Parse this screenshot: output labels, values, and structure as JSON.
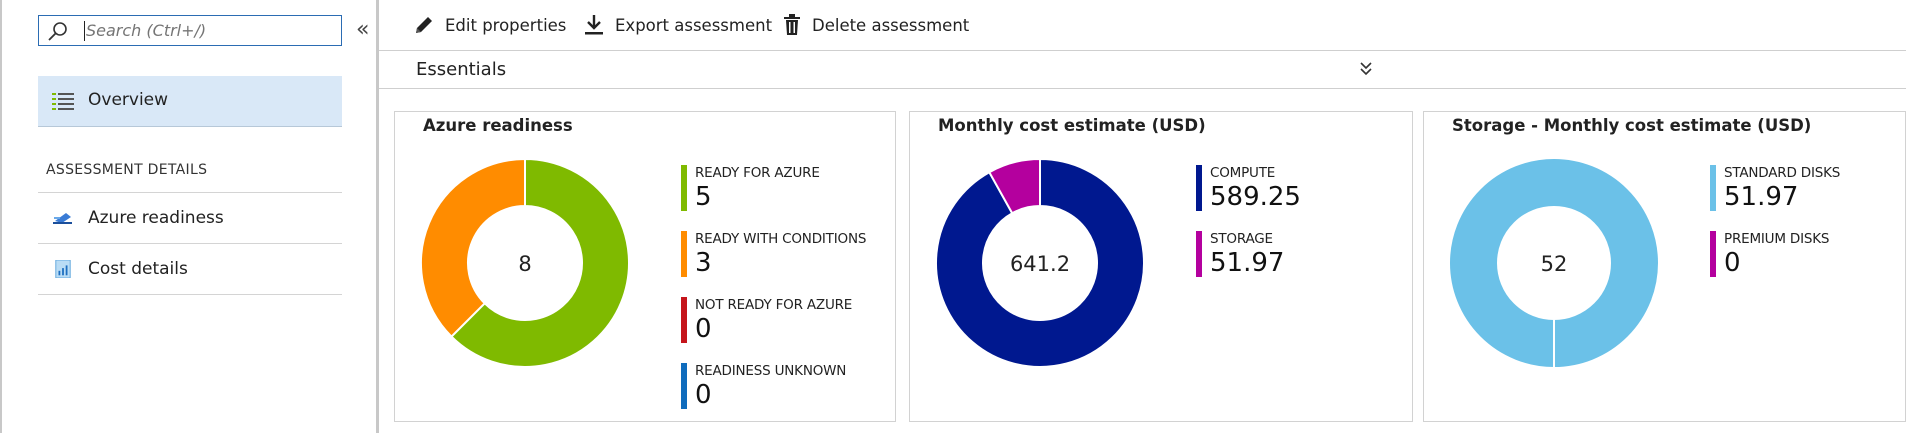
{
  "sidebar": {
    "search_placeholder": "Search (Ctrl+/)",
    "overview_label": "Overview",
    "section_title": "ASSESSMENT DETAILS",
    "items": [
      {
        "label": "Azure readiness",
        "icon": "azure-readiness-icon"
      },
      {
        "label": "Cost details",
        "icon": "cost-details-icon"
      }
    ]
  },
  "toolbar": {
    "edit_label": "Edit properties",
    "export_label": "Export assessment",
    "delete_label": "Delete assessment"
  },
  "essentials": {
    "label": "Essentials"
  },
  "tiles": [
    {
      "title": "Azure readiness",
      "center": "8",
      "legend": [
        {
          "label": "READY FOR AZURE",
          "value": "5",
          "color": "#7fba00"
        },
        {
          "label": "READY WITH CONDITIONS",
          "value": "3",
          "color": "#ff8c00"
        },
        {
          "label": "NOT READY FOR AZURE",
          "value": "0",
          "color": "#c5151b"
        },
        {
          "label": "READINESS UNKNOWN",
          "value": "0",
          "color": "#0f6cbd"
        }
      ]
    },
    {
      "title": "Monthly cost estimate (USD)",
      "center": "641.2",
      "legend": [
        {
          "label": "COMPUTE",
          "value": "589.25",
          "color": "#00188f"
        },
        {
          "label": "STORAGE",
          "value": "51.97",
          "color": "#b4009e"
        }
      ]
    },
    {
      "title": "Storage - Monthly cost estimate (USD)",
      "center": "52",
      "legend": [
        {
          "label": "STANDARD DISKS",
          "value": "51.97",
          "color": "#6bc1e8"
        },
        {
          "label": "PREMIUM DISKS",
          "value": "0",
          "color": "#b4009e"
        }
      ]
    }
  ],
  "chart_data": [
    {
      "type": "pie",
      "title": "Azure readiness",
      "categories": [
        "READY FOR AZURE",
        "READY WITH CONDITIONS",
        "NOT READY FOR AZURE",
        "READINESS UNKNOWN"
      ],
      "values": [
        5,
        3,
        0,
        0
      ],
      "total": 8
    },
    {
      "type": "pie",
      "title": "Monthly cost estimate (USD)",
      "categories": [
        "COMPUTE",
        "STORAGE"
      ],
      "values": [
        589.25,
        51.97
      ],
      "total": 641.2
    },
    {
      "type": "pie",
      "title": "Storage - Monthly cost estimate (USD)",
      "categories": [
        "STANDARD DISKS",
        "PREMIUM DISKS"
      ],
      "values": [
        51.97,
        0
      ],
      "total": 52
    }
  ]
}
